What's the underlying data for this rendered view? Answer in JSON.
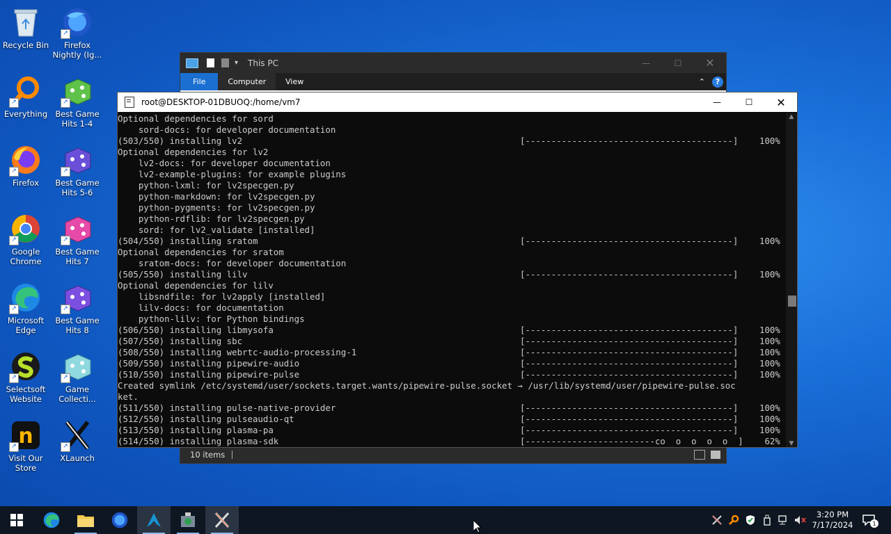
{
  "desktop": {
    "icons": [
      {
        "label": "Recycle Bin",
        "icon": "recycle-bin-icon"
      },
      {
        "label": "Firefox Nightly (Ig...",
        "icon": "firefox-nightly-icon"
      },
      {
        "label": "Everything",
        "icon": "everything-search-icon"
      },
      {
        "label": "Best Game Hits 1-4",
        "icon": "game-dice-icon"
      },
      {
        "label": "Firefox",
        "icon": "firefox-icon"
      },
      {
        "label": "Best Game Hits 5-6",
        "icon": "game-dice-icon"
      },
      {
        "label": "Google Chrome",
        "icon": "chrome-icon"
      },
      {
        "label": "Best Game Hits 7",
        "icon": "game-dice-icon"
      },
      {
        "label": "Microsoft Edge",
        "icon": "edge-icon"
      },
      {
        "label": "Best Game Hits 8",
        "icon": "game-dice-icon"
      },
      {
        "label": "Selectsoft Website",
        "icon": "selectsoft-icon"
      },
      {
        "label": "Game Collecti...",
        "icon": "game-dice-icon"
      },
      {
        "label": "Visit Our Store",
        "icon": "store-icon"
      },
      {
        "label": "XLaunch",
        "icon": "xlaunch-icon"
      }
    ]
  },
  "explorer": {
    "title": "This PC",
    "tabs": [
      "File",
      "Computer",
      "View"
    ],
    "status": "10 items"
  },
  "terminal": {
    "title": "root@DESKTOP-01DBUOQ:/home/vm7",
    "lines": [
      {
        "text": "Optional dependencies for sord"
      },
      {
        "text": "    sord-docs: for developer documentation"
      },
      {
        "text": "(503/550) installing lv2",
        "bar": "[----------------------------------------]",
        "pct": "100%"
      },
      {
        "text": "Optional dependencies for lv2"
      },
      {
        "text": "    lv2-docs: for developer documentation"
      },
      {
        "text": "    lv2-example-plugins: for example plugins"
      },
      {
        "text": "    python-lxml: for lv2specgen.py"
      },
      {
        "text": "    python-markdown: for lv2specgen.py"
      },
      {
        "text": "    python-pygments: for lv2specgen.py"
      },
      {
        "text": "    python-rdflib: for lv2specgen.py"
      },
      {
        "text": "    sord: for lv2_validate [installed]"
      },
      {
        "text": "(504/550) installing sratom",
        "bar": "[----------------------------------------]",
        "pct": "100%"
      },
      {
        "text": "Optional dependencies for sratom"
      },
      {
        "text": "    sratom-docs: for developer documentation"
      },
      {
        "text": "(505/550) installing lilv",
        "bar": "[----------------------------------------]",
        "pct": "100%"
      },
      {
        "text": "Optional dependencies for lilv"
      },
      {
        "text": "    libsndfile: for lv2apply [installed]"
      },
      {
        "text": "    lilv-docs: for documentation"
      },
      {
        "text": "    python-lilv: for Python bindings"
      },
      {
        "text": "(506/550) installing libmysofa",
        "bar": "[----------------------------------------]",
        "pct": "100%"
      },
      {
        "text": "(507/550) installing sbc",
        "bar": "[----------------------------------------]",
        "pct": "100%"
      },
      {
        "text": "(508/550) installing webrtc-audio-processing-1",
        "bar": "[----------------------------------------]",
        "pct": "100%"
      },
      {
        "text": "(509/550) installing pipewire-audio",
        "bar": "[----------------------------------------]",
        "pct": "100%"
      },
      {
        "text": "(510/550) installing pipewire-pulse",
        "bar": "[----------------------------------------]",
        "pct": "100%"
      },
      {
        "text": "Created symlink /etc/systemd/user/sockets.target.wants/pipewire-pulse.socket → /usr/lib/systemd/user/pipewire-pulse.soc"
      },
      {
        "text": "ket."
      },
      {
        "text": "(511/550) installing pulse-native-provider",
        "bar": "[----------------------------------------]",
        "pct": "100%"
      },
      {
        "text": "(512/550) installing pulseaudio-qt",
        "bar": "[----------------------------------------]",
        "pct": "100%"
      },
      {
        "text": "(513/550) installing plasma-pa",
        "bar": "[----------------------------------------]",
        "pct": "100%"
      },
      {
        "text": "(514/550) installing plasma-sdk",
        "bar": "[-------------------------co  o  o  o  o  ]",
        "pct": " 62%"
      }
    ]
  },
  "taskbar": {
    "apps": [
      "start-icon",
      "edge-icon",
      "file-explorer-icon",
      "firefox-icon",
      "arch-terminal-icon",
      "game-manager-icon",
      "xlaunch-icon"
    ],
    "clock": {
      "time": "3:20 PM",
      "date": "7/17/2024"
    },
    "notification_count": "1"
  }
}
